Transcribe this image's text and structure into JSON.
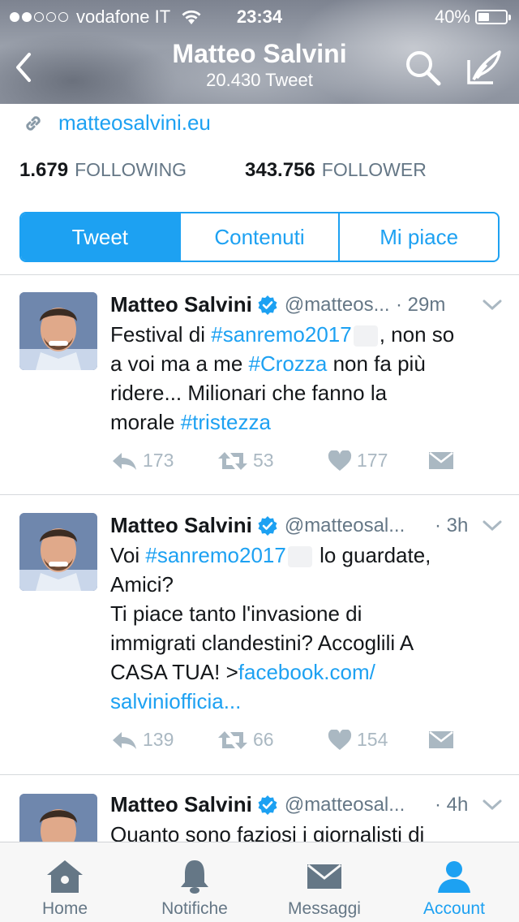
{
  "status_bar": {
    "carrier": "vodafone IT",
    "time": "23:34",
    "battery": "40%"
  },
  "header": {
    "title": "Matteo Salvini",
    "subtitle": "20.430 Tweet"
  },
  "profile": {
    "link": "matteosalvini.eu",
    "following_count": "1.679",
    "following_label": "FOLLOWING",
    "follower_count": "343.756",
    "follower_label": "FOLLOWER"
  },
  "tabs": [
    {
      "label": "Tweet"
    },
    {
      "label": "Contenuti"
    },
    {
      "label": "Mi piace"
    }
  ],
  "tweets": [
    {
      "name": "Matteo Salvini",
      "handle": "@matteos...",
      "time": "· 29m",
      "t": [
        "Festival di ",
        "#sanremo2017",
        ", non so",
        "a voi ma a me ",
        "#Crozza",
        " non fa più",
        "ridere... Milionari che fanno la",
        "morale ",
        "#tristezza"
      ],
      "replies": "173",
      "retweets": "53",
      "likes": "177"
    },
    {
      "name": "Matteo Salvini",
      "handle": "@matteosal...",
      "time": "· 3h",
      "t": [
        "Voi ",
        "#sanremo2017",
        " lo guardate,",
        "Amici?",
        "Ti piace tanto l'invasione di",
        "immigrati clandestini? Accoglili A",
        "CASA TUA! >",
        "facebook.com/",
        "salviniofficia..."
      ],
      "replies": "139",
      "retweets": "66",
      "likes": "154"
    },
    {
      "name": "Matteo Salvini",
      "handle": "@matteosal...",
      "time": "· 4h",
      "t": [
        "Quanto sono faziosi i giornalisti di"
      ]
    }
  ],
  "tabbar": [
    {
      "label": "Home"
    },
    {
      "label": "Notifiche"
    },
    {
      "label": "Messaggi"
    },
    {
      "label": "Account"
    }
  ],
  "colors": {
    "accent": "#1da1f2",
    "text": "#14171a",
    "muted": "#657786",
    "action": "#aab8c2"
  }
}
